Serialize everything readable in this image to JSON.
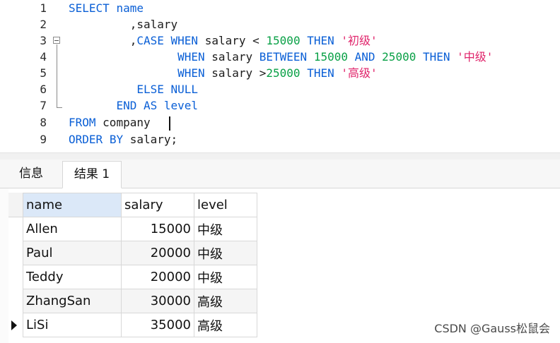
{
  "editor": {
    "lines": [
      {
        "n": "1"
      },
      {
        "n": "2"
      },
      {
        "n": "3"
      },
      {
        "n": "4"
      },
      {
        "n": "5"
      },
      {
        "n": "6"
      },
      {
        "n": "7"
      },
      {
        "n": "8"
      },
      {
        "n": "9"
      }
    ],
    "tokens": {
      "select": "SELECT",
      "name": "name",
      "comma_salary": ",salary",
      "comma": ",",
      "case": "CASE",
      "when": "WHEN",
      "salary": "salary",
      "lt": "<",
      "n15000": "15000",
      "then": "THEN",
      "s_junior": "'初级'",
      "between": "BETWEEN",
      "and": "AND",
      "n25000": "25000",
      "s_mid": "'中级'",
      "gt": ">",
      "s_senior": "'高级'",
      "else": "ELSE",
      "null": "NULL",
      "end": "END",
      "as": "AS",
      "level": "level",
      "from": "FROM",
      "company": "company",
      "order": "ORDER",
      "by": "BY",
      "salary_semicolon": "salary;"
    }
  },
  "tabs": {
    "info": "信息",
    "result": "结果 1"
  },
  "grid": {
    "headers": [
      "name",
      "salary",
      "level"
    ],
    "rows": [
      [
        "Allen",
        "15000",
        "中级"
      ],
      [
        "Paul",
        "20000",
        "中级"
      ],
      [
        "Teddy",
        "20000",
        "中级"
      ],
      [
        "ZhangSan",
        "30000",
        "高级"
      ],
      [
        "LiSi",
        "35000",
        "高级"
      ]
    ]
  },
  "watermark": "CSDN @Gauss松鼠会"
}
